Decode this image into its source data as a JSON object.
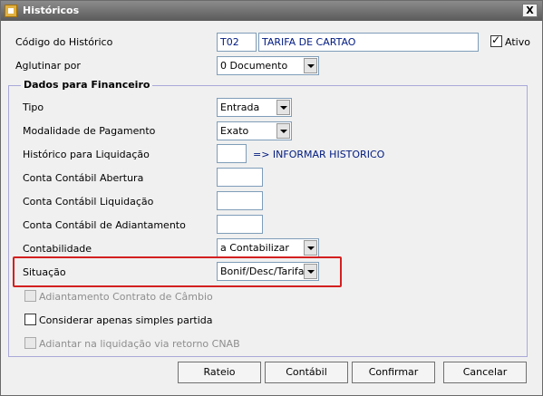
{
  "window": {
    "title": "Históricos",
    "close_label": "X"
  },
  "header": {
    "codigo_label": "Código do Histórico",
    "codigo_value": "T02",
    "descricao_value": "TARIFA DE CARTAO",
    "ativo_label": "Ativo",
    "ativo_checked": true,
    "aglutinar_label": "Aglutinar por",
    "aglutinar_value": "0 Documento"
  },
  "financeiro": {
    "group_title": "Dados para Financeiro",
    "tipo_label": "Tipo",
    "tipo_value": "Entrada",
    "modalidade_label": "Modalidade de Pagamento",
    "modalidade_value": "Exato",
    "liquidacao_label": "Histórico para Liquidação",
    "liquidacao_hint": "=> INFORMAR HISTORICO",
    "conta_abertura_label": "Conta Contábil Abertura",
    "conta_liquidacao_label": "Conta Contábil Liquidação",
    "conta_adiantamento_label": "Conta Contábil de Adiantamento",
    "contabilidade_label": "Contabilidade",
    "contabilidade_value": "a Contabilizar",
    "situacao_label": "Situação",
    "situacao_value": "Bonif/Desc/Tarifa",
    "adiantamento_cambio_label": "Adiantamento Contrato de Câmbio",
    "simples_partida_label": "Considerar apenas simples partida",
    "adiantar_cnab_label": "Adiantar na liquidação via retorno CNAB"
  },
  "buttons": {
    "rateio": "Rateio",
    "contabil": "Contábil",
    "confirmar": "Confirmar",
    "cancelar": "Cancelar"
  }
}
